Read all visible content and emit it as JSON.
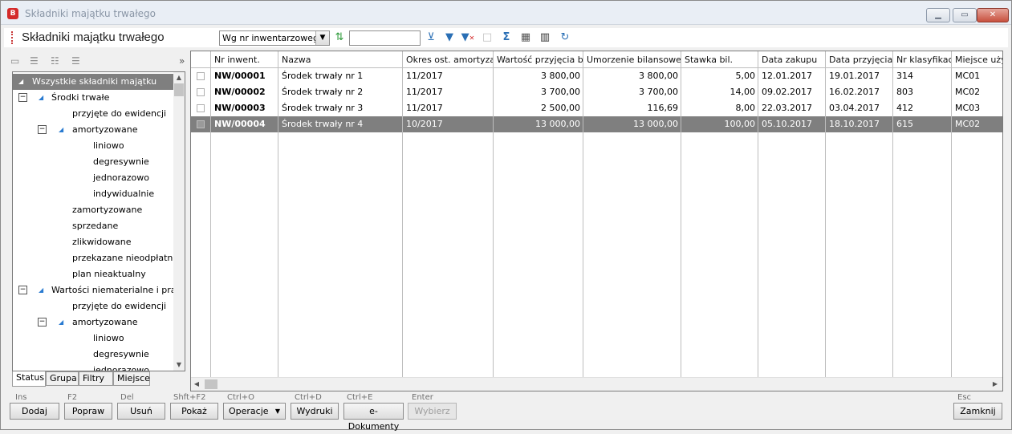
{
  "window": {
    "title": "Składniki majątku trwałego",
    "app_badge": "B",
    "controls": [
      "minimize",
      "maximize",
      "close"
    ]
  },
  "toolbar": {
    "title": "Składniki majątku trwałego",
    "sort_select": "Wg nr inwentarzowego",
    "search_value": "",
    "icons": [
      "sort-up-down-icon",
      "filter-clear-icon",
      "filter-icon",
      "filter-remove-icon",
      "checkbox-icon",
      "sum-icon",
      "add-asset-icon",
      "barcode-icon",
      "refresh-icon"
    ]
  },
  "left_panel": {
    "collapse_label": "»",
    "tree": [
      {
        "label": "Wszystkie składniki majątku",
        "selected": true
      },
      {
        "label": "Środki trwałe",
        "expander": "−"
      },
      {
        "label": "przyjęte do ewidencji"
      },
      {
        "label": "amortyzowane",
        "expander": "−"
      },
      {
        "label": "liniowo"
      },
      {
        "label": "degresywnie"
      },
      {
        "label": "jednorazowo"
      },
      {
        "label": "indywidualnie"
      },
      {
        "label": "zamortyzowane"
      },
      {
        "label": "sprzedane"
      },
      {
        "label": "zlikwidowane"
      },
      {
        "label": "przekazane nieodpłatnie"
      },
      {
        "label": "plan nieaktualny"
      },
      {
        "label": "Wartości niematerialne i prawne",
        "expander": "−"
      },
      {
        "label": "przyjęte do ewidencji"
      },
      {
        "label": "amortyzowane",
        "expander": "−"
      },
      {
        "label": "liniowo"
      },
      {
        "label": "degresywnie"
      },
      {
        "label": "jednorazowo"
      }
    ],
    "tabs": [
      "Status",
      "Grupa",
      "Filtry",
      "Miejsce"
    ]
  },
  "grid": {
    "columns": [
      "Nr inwent.",
      "Nazwa",
      "Okres ost. amortyzacji",
      "Wartość przyjęcia bilansowa",
      "Umorzenie bilansowe",
      "Stawka bil.",
      "Data zakupu",
      "Data przyjęcia",
      "Nr klasyfikacji",
      "Miejsce używania"
    ],
    "rows": [
      {
        "nr": "NW/00001",
        "nazwa": "Środek trwały nr 1",
        "okres": "11/2017",
        "wartosc": "3 800,00",
        "umorzenie": "3 800,00",
        "stawka": "5,00",
        "zakup": "12.01.2017",
        "przyjecie": "19.01.2017",
        "klas": "314",
        "miejsce": "MC01"
      },
      {
        "nr": "NW/00002",
        "nazwa": "Środek trwały nr 2",
        "okres": "11/2017",
        "wartosc": "3 700,00",
        "umorzenie": "3 700,00",
        "stawka": "14,00",
        "zakup": "09.02.2017",
        "przyjecie": "16.02.2017",
        "klas": "803",
        "miejsce": "MC02"
      },
      {
        "nr": "NW/00003",
        "nazwa": "Środek trwały nr 3",
        "okres": "11/2017",
        "wartosc": "2 500,00",
        "umorzenie": "116,69",
        "stawka": "8,00",
        "zakup": "22.03.2017",
        "przyjecie": "03.04.2017",
        "klas": "412",
        "miejsce": "MC03"
      },
      {
        "nr": "NW/00004",
        "nazwa": "Środek trwały nr 4",
        "okres": "10/2017",
        "wartosc": "13 000,00",
        "umorzenie": "13 000,00",
        "stawka": "100,00",
        "zakup": "05.10.2017",
        "przyjecie": "18.10.2017",
        "klas": "615",
        "miejsce": "MC02",
        "selected": true
      }
    ]
  },
  "buttons": [
    {
      "shortcut": "Ins",
      "label": "Dodaj"
    },
    {
      "shortcut": "F2",
      "label": "Popraw"
    },
    {
      "shortcut": "Del",
      "label": "Usuń"
    },
    {
      "shortcut": "Shft+F2",
      "label": "Pokaż"
    },
    {
      "shortcut": "Ctrl+O",
      "label": "Operacje"
    },
    {
      "shortcut": "Ctrl+D",
      "label": "Wydruki"
    },
    {
      "shortcut": "Ctrl+E",
      "label": "e-Dokumenty"
    },
    {
      "shortcut": "Enter",
      "label": "Wybierz",
      "disabled": true
    },
    {
      "shortcut": "Esc",
      "label": "Zamknij"
    }
  ],
  "colors": {
    "selection": "#7f7f7f",
    "accent_red": "#d42a2a",
    "tree_triangle": "#2a7bd1"
  }
}
